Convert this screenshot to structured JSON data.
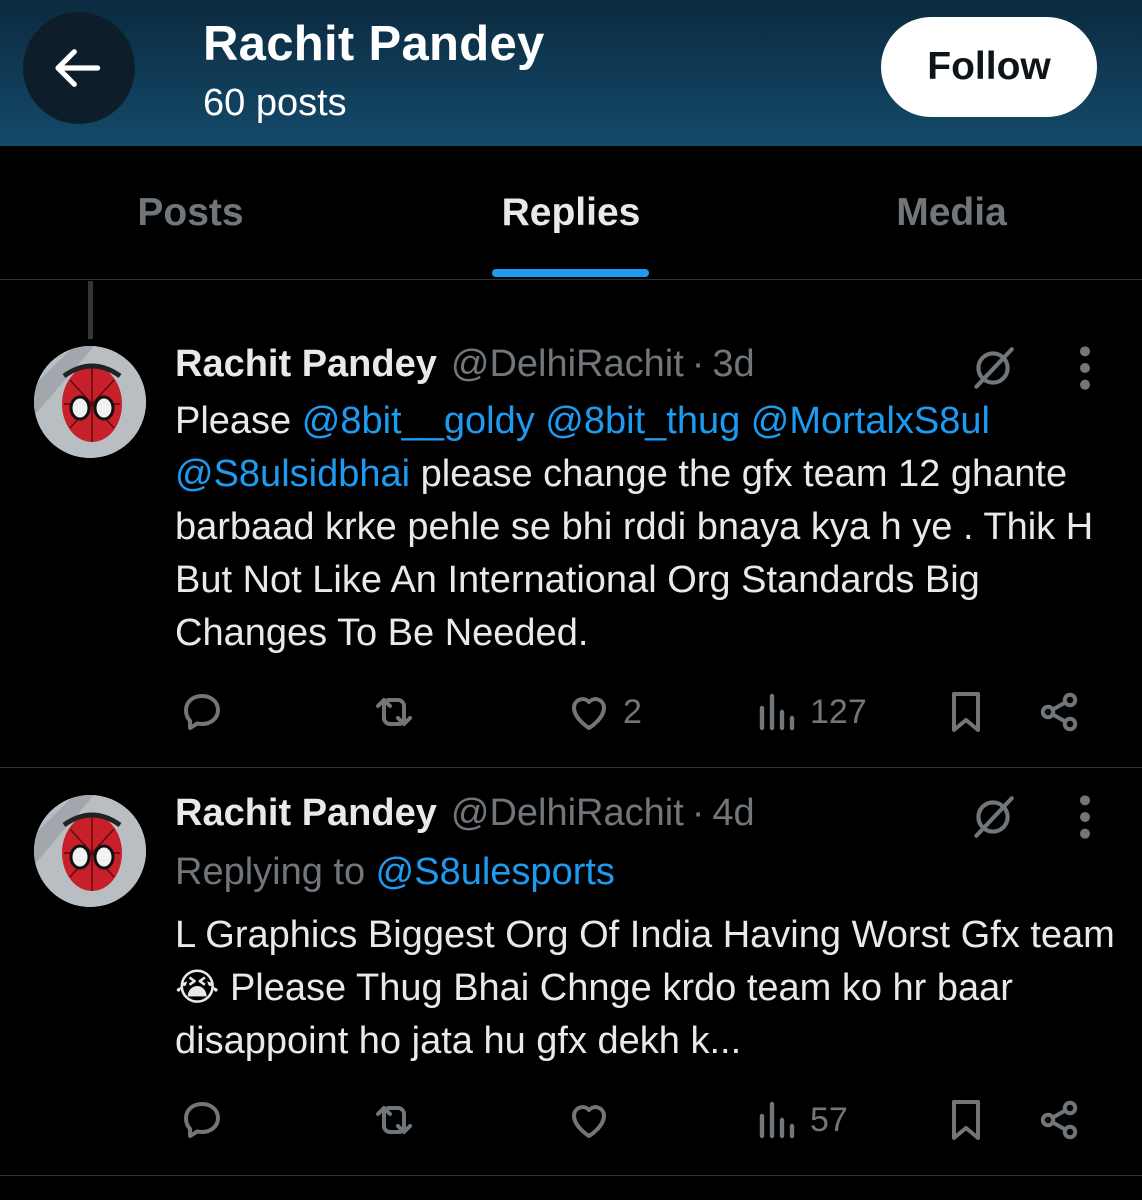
{
  "header": {
    "back_icon": "arrow-left-icon",
    "title": "Rachit Pandey",
    "subtitle": "60 posts",
    "follow_label": "Follow"
  },
  "tabs": [
    {
      "label": "Posts",
      "active": false
    },
    {
      "label": "Replies",
      "active": true
    },
    {
      "label": "Media",
      "active": false
    }
  ],
  "colors": {
    "accent": "#1d9bf0",
    "background": "#000000",
    "muted": "#71767b",
    "header_gradient_top": "#0b2a3f",
    "header_gradient_bottom": "#144a6a"
  },
  "posts": [
    {
      "name": "Rachit Pandey",
      "handle": "@DelhiRachit",
      "dot": "·",
      "time": "3d",
      "text_segments": [
        {
          "text": "Please ",
          "mention": false
        },
        {
          "text": "@8bit__goldy",
          "mention": true
        },
        {
          "text": " ",
          "mention": false
        },
        {
          "text": "@8bit_thug",
          "mention": true
        },
        {
          "text": " ",
          "mention": false
        },
        {
          "text": "@MortalxS8ul",
          "mention": true
        },
        {
          "text": " ",
          "mention": false
        },
        {
          "text": "@S8ulsidbhai",
          "mention": true
        },
        {
          "text": " please change the gfx team 12 ghante barbaad krke pehle se bhi rddi bnaya kya h ye . Thik H But Not Like An International Org Standards Big Changes To Be Needed.",
          "mention": false
        }
      ],
      "actions": {
        "reply_icon": "reply-icon",
        "repost_icon": "repost-icon",
        "like_icon": "heart-icon",
        "likes": "2",
        "views_icon": "views-icon",
        "views": "127",
        "bookmark_icon": "bookmark-icon",
        "share_icon": "share-icon"
      }
    },
    {
      "name": "Rachit Pandey",
      "handle": "@DelhiRachit",
      "dot": "·",
      "time": "4d",
      "replying_prefix": "Replying to ",
      "replying_to": "@S8ulesports",
      "text": "L Graphics Biggest Org Of India Having Worst Gfx team 😭 Please Thug Bhai Chnge krdo team ko hr baar disappoint ho jata hu gfx dekh k...",
      "actions": {
        "reply_icon": "reply-icon",
        "repost_icon": "repost-icon",
        "like_icon": "heart-icon",
        "likes": "",
        "views_icon": "views-icon",
        "views": "57",
        "bookmark_icon": "bookmark-icon",
        "share_icon": "share-icon"
      }
    }
  ]
}
